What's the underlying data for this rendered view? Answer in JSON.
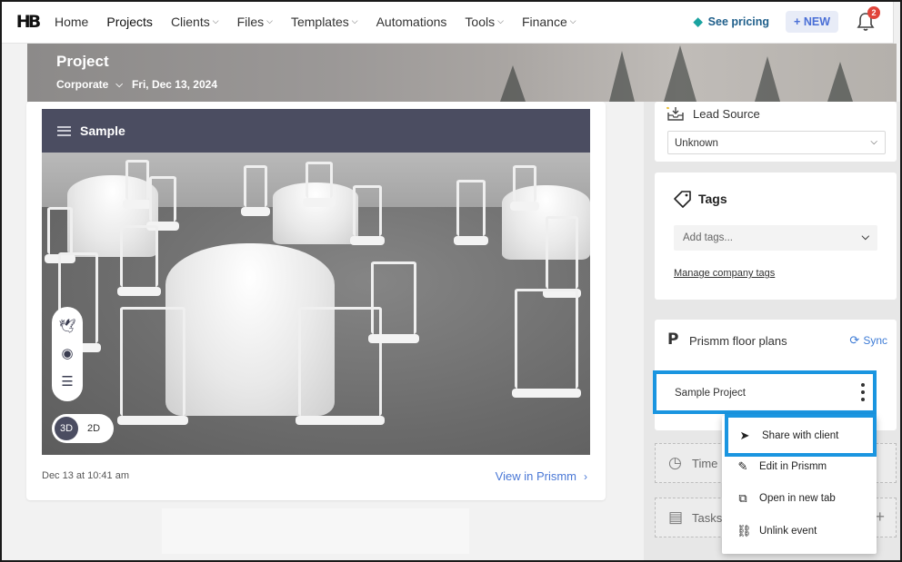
{
  "nav": {
    "logo": "HB",
    "items": [
      {
        "label": "Home",
        "dropdown": false
      },
      {
        "label": "Projects",
        "dropdown": false
      },
      {
        "label": "Clients",
        "dropdown": true
      },
      {
        "label": "Files",
        "dropdown": true
      },
      {
        "label": "Templates",
        "dropdown": true
      },
      {
        "label": "Automations",
        "dropdown": false
      },
      {
        "label": "Tools",
        "dropdown": true
      },
      {
        "label": "Finance",
        "dropdown": true
      }
    ],
    "pricing_label": "See pricing",
    "new_label": "NEW",
    "notification_count": "2"
  },
  "hero": {
    "title": "Project",
    "company": "Corporate",
    "date": "Fri, Dec 13, 2024"
  },
  "viewer": {
    "title": "Sample",
    "mode_3d": "3D",
    "mode_2d": "2D",
    "tools": [
      "dove-icon",
      "compass-icon",
      "sliders-icon"
    ],
    "timestamp": "Dec 13 at 10:41 am",
    "view_link": "View in Prismm"
  },
  "lead_source": {
    "title": "Lead Source",
    "value": "Unknown"
  },
  "tags": {
    "title": "Tags",
    "placeholder": "Add tags...",
    "manage_link": "Manage company tags"
  },
  "prismm": {
    "title": "Prismm floor plans",
    "sync_label": "Sync",
    "project_name": "Sample Project"
  },
  "collapsed_sections": {
    "time_label": "Time",
    "tasks_label": "Tasks"
  },
  "context_menu": {
    "items": [
      {
        "label": "Share with client",
        "icon": "send-icon"
      },
      {
        "label": "Edit in Prismm",
        "icon": "pencil-icon"
      },
      {
        "label": "Open in new tab",
        "icon": "external-link-icon"
      },
      {
        "label": "Unlink event",
        "icon": "unlink-icon"
      }
    ]
  },
  "colors": {
    "accent_blue": "#4a78d6",
    "highlight_blue": "#1a95e0",
    "viewer_header": "#4b4d61",
    "badge_red": "#e0443a"
  }
}
